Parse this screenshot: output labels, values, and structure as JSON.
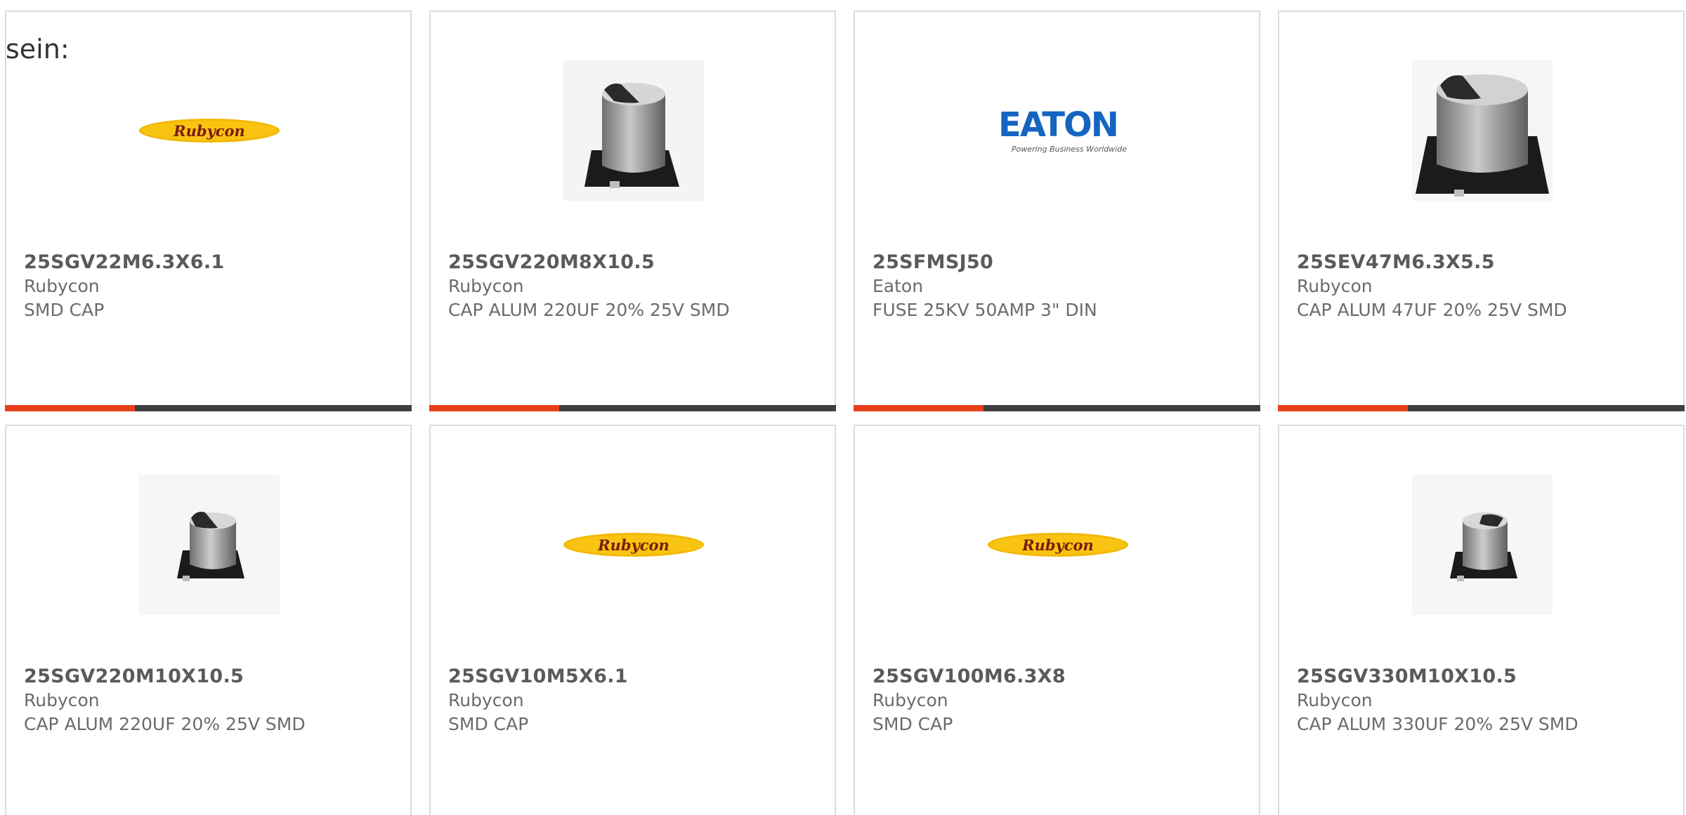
{
  "intro_text": "sein:",
  "colors": {
    "accent": "#e8401c",
    "bar_track": "#3f3f3f",
    "card_border": "#dcdcdc",
    "text": "#6b6b6b"
  },
  "products": [
    {
      "part_number": "25SGV22M6.3X6.1",
      "manufacturer": "Rubycon",
      "description": "SMD CAP",
      "image": "rubycon-logo",
      "logo_text": "Rubycon",
      "progress": 0.32
    },
    {
      "part_number": "25SGV220M8X10.5",
      "manufacturer": "Rubycon",
      "description": "CAP ALUM 220UF 20% 25V SMD",
      "image": "smd-capacitor-photo",
      "progress": 0.32
    },
    {
      "part_number": "25SFMSJ50",
      "manufacturer": "Eaton",
      "description": "FUSE 25KV 50AMP 3\" DIN",
      "image": "eaton-logo",
      "logo_text": "EATON",
      "logo_tagline": "Powering Business Worldwide",
      "progress": 0.32
    },
    {
      "part_number": "25SEV47M6.3X5.5",
      "manufacturer": "Rubycon",
      "description": "CAP ALUM 47UF 20% 25V SMD",
      "image": "smd-capacitor-photo",
      "progress": 0.32
    },
    {
      "part_number": "25SGV220M10X10.5",
      "manufacturer": "Rubycon",
      "description": "CAP ALUM 220UF 20% 25V SMD",
      "image": "smd-capacitor-photo"
    },
    {
      "part_number": "25SGV10M5X6.1",
      "manufacturer": "Rubycon",
      "description": "SMD CAP",
      "image": "rubycon-logo",
      "logo_text": "Rubycon"
    },
    {
      "part_number": "25SGV100M6.3X8",
      "manufacturer": "Rubycon",
      "description": "SMD CAP",
      "image": "rubycon-logo",
      "logo_text": "Rubycon"
    },
    {
      "part_number": "25SGV330M10X10.5",
      "manufacturer": "Rubycon",
      "description": "CAP ALUM 330UF 20% 25V SMD",
      "image": "smd-capacitor-photo"
    }
  ]
}
